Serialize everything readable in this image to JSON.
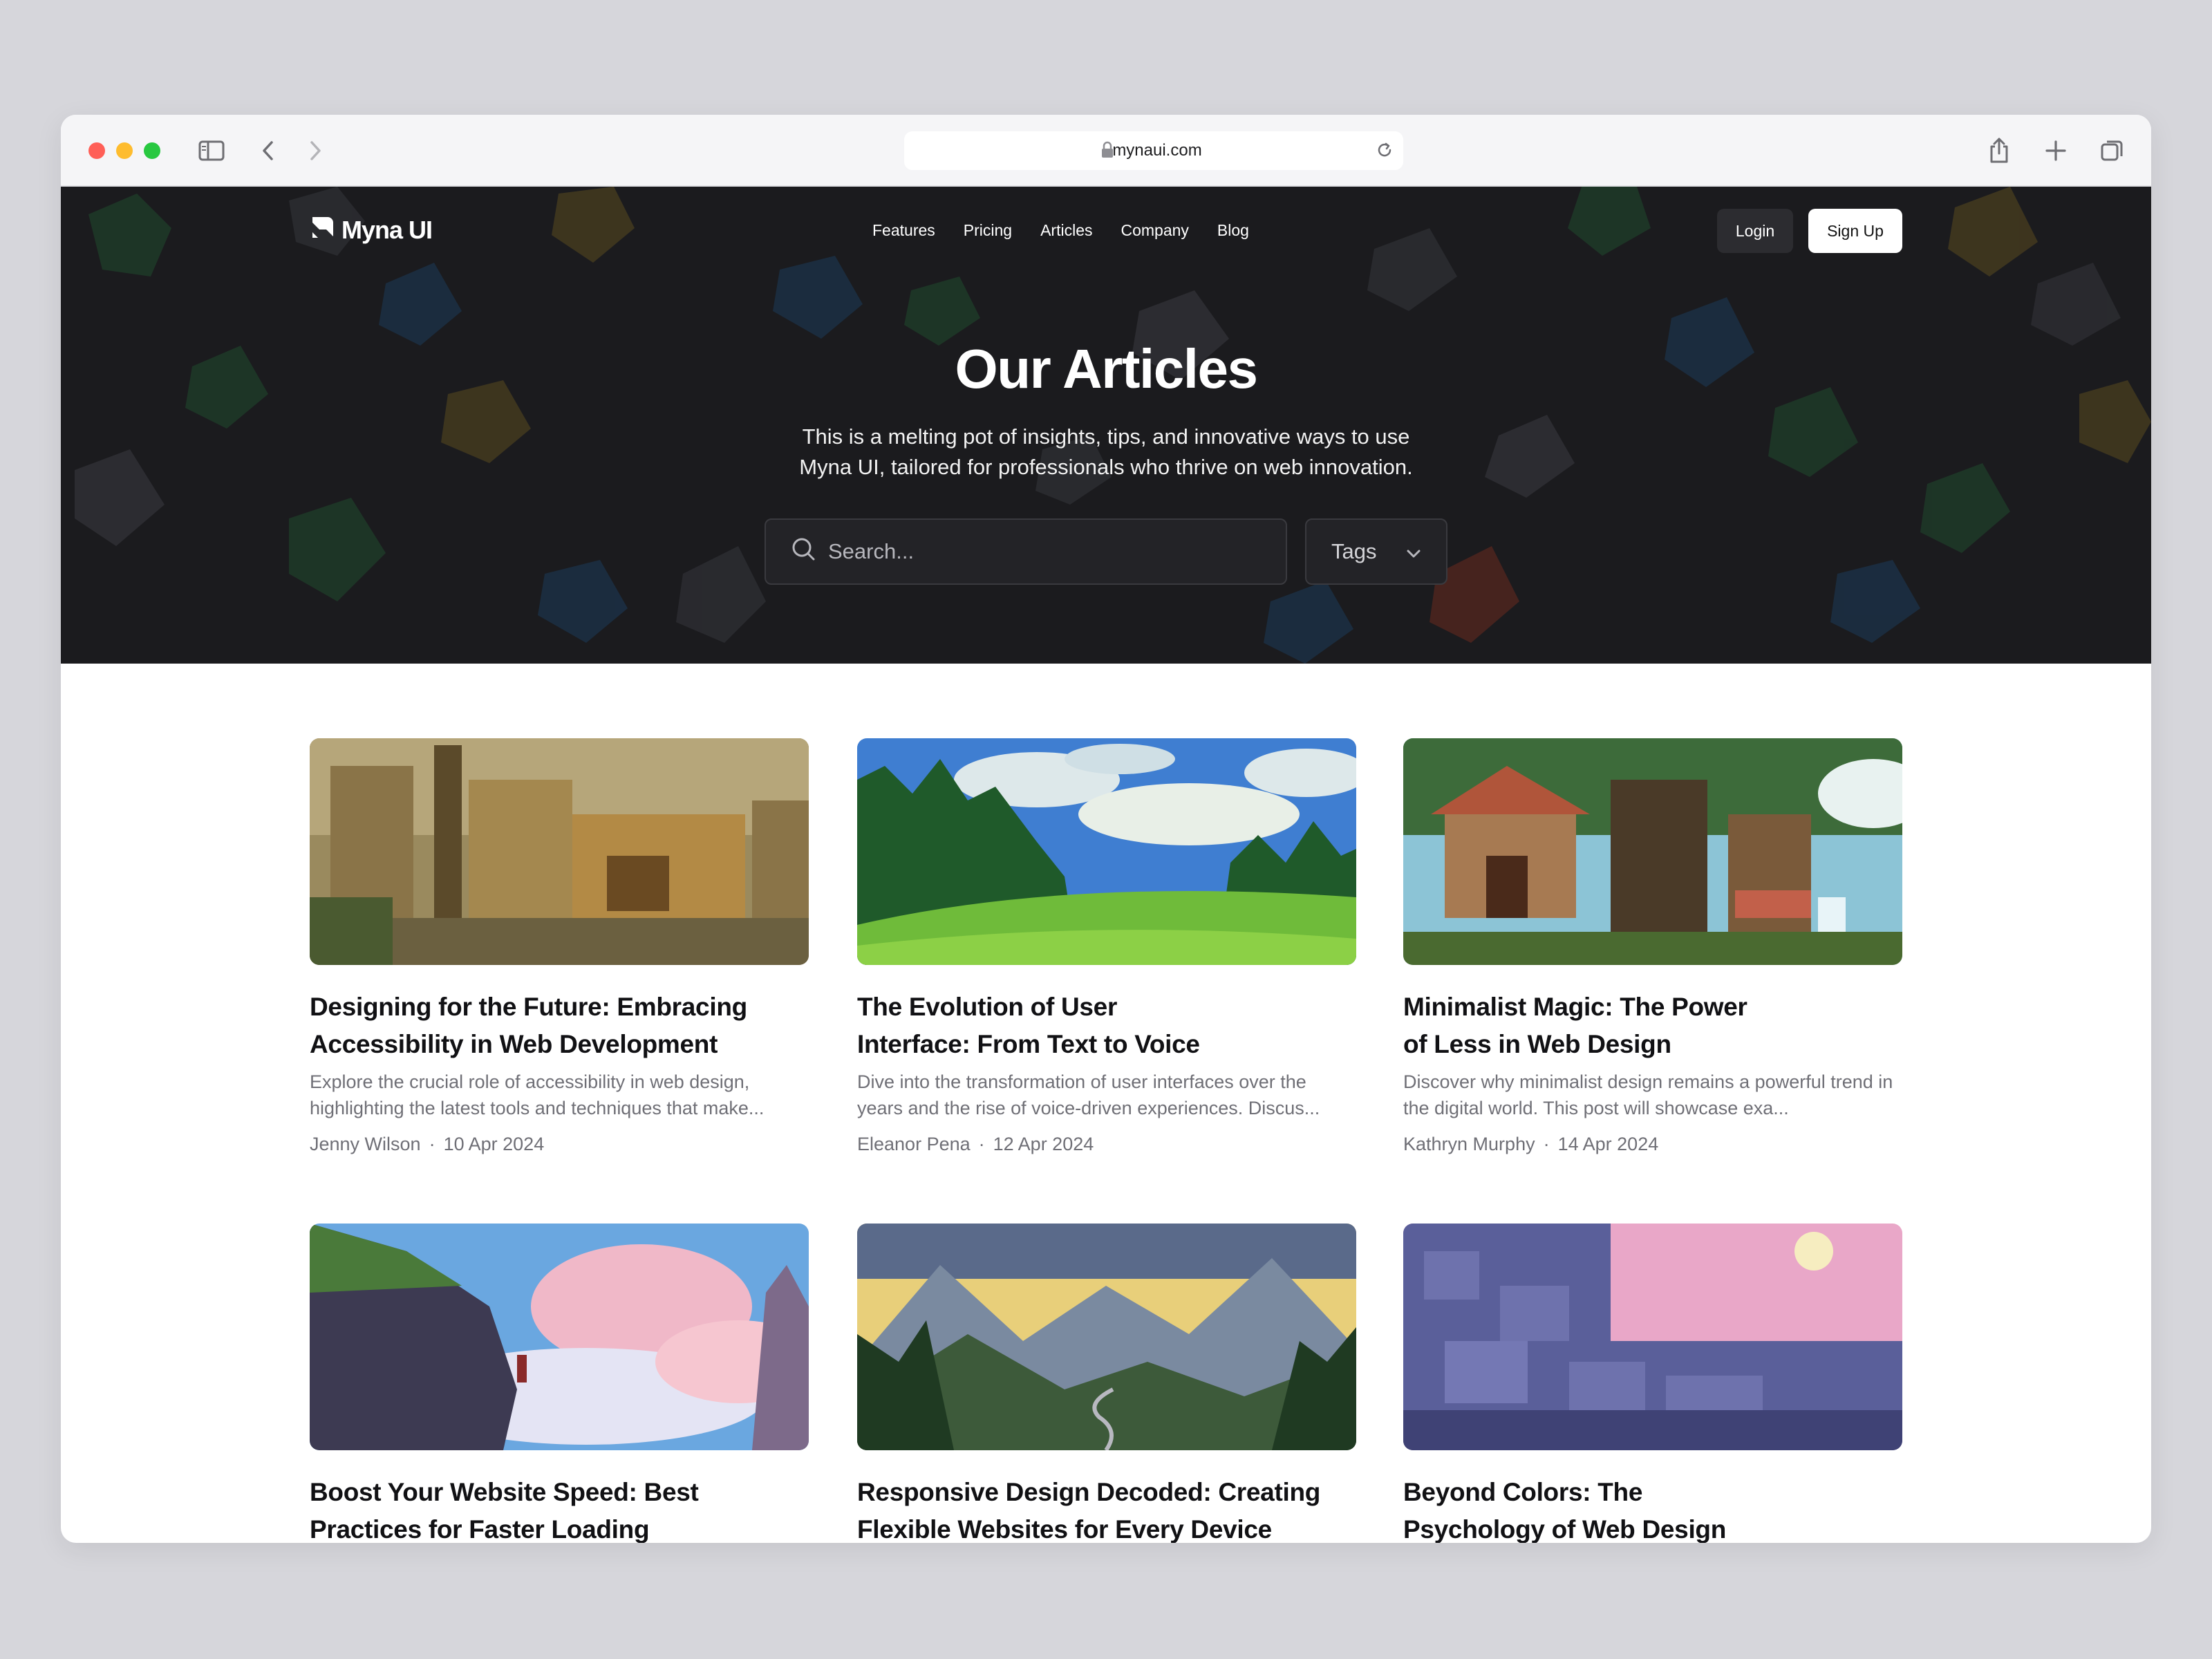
{
  "browser": {
    "url": "mynaui.com"
  },
  "nav": {
    "brand": "Myna UI",
    "links": [
      "Features",
      "Pricing",
      "Articles",
      "Company",
      "Blog"
    ],
    "login": "Login",
    "signup": "Sign Up"
  },
  "hero": {
    "title": "Our Articles",
    "subtitle_line1": "This is a melting pot of insights, tips, and innovative ways to use",
    "subtitle_line2": "Myna UI, tailored for professionals who thrive on web innovation.",
    "search_placeholder": "Search...",
    "tags_label": "Tags"
  },
  "articles": [
    {
      "title_line1": "Designing for the Future: Embracing",
      "title_line2": "Accessibility in Web Development",
      "excerpt": "Explore the crucial role of accessibility in web design, highlighting the latest tools and techniques that make...",
      "author": "Jenny Wilson",
      "date": "10 Apr 2024"
    },
    {
      "title_line1": "The Evolution of User",
      "title_line2": "Interface: From Text to Voice",
      "excerpt": "Dive into the transformation of user interfaces over the years and the rise of voice-driven experiences. Discus...",
      "author": "Eleanor Pena",
      "date": "12 Apr 2024"
    },
    {
      "title_line1": "Minimalist Magic: The Power",
      "title_line2": "of Less in Web Design",
      "excerpt": "Discover why minimalist design remains a powerful trend in the digital world. This post will showcase exa...",
      "author": "Kathryn Murphy",
      "date": "14 Apr 2024"
    },
    {
      "title_line1": "Boost Your Website Speed: Best",
      "title_line2": "Practices for Faster Loading"
    },
    {
      "title_line1": "Responsive Design Decoded: Creating",
      "title_line2": "Flexible Websites for Every Device"
    },
    {
      "title_line1": "Beyond Colors: The",
      "title_line2": "Psychology of Web Design"
    }
  ],
  "meta_separator": "·",
  "colors": {
    "hero_bg": "#1b1b1e",
    "page_bg": "#d6d6db",
    "text_primary": "#111114",
    "text_muted": "#6f6f76"
  },
  "icons": [
    "sidebar-icon",
    "back-icon",
    "forward-icon",
    "lock-icon",
    "reload-icon",
    "share-icon",
    "new-tab-icon",
    "tabs-icon",
    "search-icon",
    "chevron-down-icon",
    "logo-icon"
  ]
}
